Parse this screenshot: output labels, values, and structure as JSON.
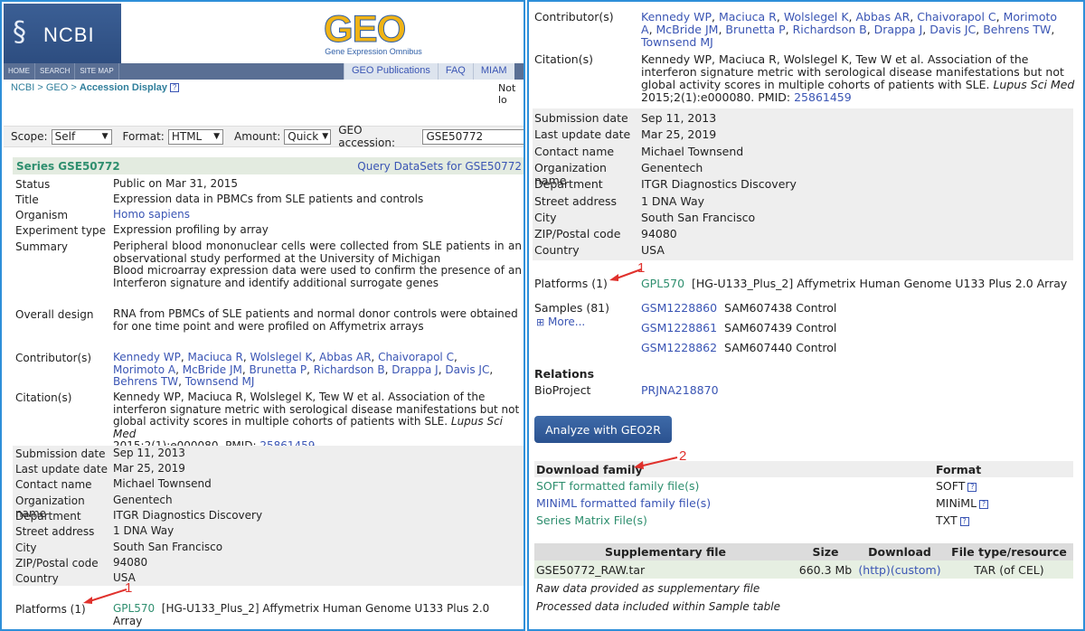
{
  "header": {
    "ncbi_text": "NCBI",
    "geo_word": "GEO",
    "geo_sub": "Gene Expression Omnibus",
    "nav": [
      "HOME",
      "SEARCH",
      "SITE MAP"
    ],
    "tabs": [
      "GEO Publications",
      "FAQ",
      "MIAM"
    ],
    "breadcrumb": {
      "ncbi": "NCBI",
      "sep1": " > ",
      "geo": "GEO",
      "sep2": " > ",
      "current": "Accession Display"
    },
    "not_logged": "Not lo"
  },
  "toolbar": {
    "scope_label": "Scope:",
    "scope_value": "Self",
    "format_label": "Format:",
    "format_value": "HTML",
    "amount_label": "Amount:",
    "amount_value": "Quick",
    "accession_label": "GEO accession:",
    "accession_value": "GSE50772"
  },
  "series": {
    "title": "Series GSE50772",
    "query_link": "Query DataSets for GSE50772"
  },
  "fields": {
    "status": {
      "label": "Status",
      "value": "Public on Mar 31, 2015"
    },
    "title": {
      "label": "Title",
      "value": "Expression data in PBMCs from SLE patients and controls"
    },
    "organism": {
      "label": "Organism",
      "value": "Homo sapiens"
    },
    "experiment_type": {
      "label": "Experiment type",
      "value": "Expression profiling by array"
    },
    "summary": {
      "label": "Summary",
      "line1": "Peripheral blood mononuclear cells were collected from SLE patients in an observational study performed at the University of Michigan",
      "line2": "Blood microarray expression data were used to confirm the presence of an Interferon signature and identify additional surrogate genes"
    },
    "overall_design": {
      "label": "Overall design",
      "value": "RNA from PBMCs of SLE patients and normal donor controls were obtained for one time point and were profiled on Affymetrix arrays"
    },
    "contributors": {
      "label": "Contributor(s)",
      "names": [
        "Kennedy WP",
        "Maciuca R",
        "Wolslegel K",
        "Abbas AR",
        "Chaivorapol C",
        "Morimoto A",
        "McBride JM",
        "Brunetta P",
        "Richardson B",
        "Drappa J",
        "Davis JC",
        "Behrens TW",
        "Townsend MJ"
      ]
    },
    "citation": {
      "label": "Citation(s)",
      "text": "Kennedy WP, Maciuca R, Wolslegel K, Tew W et al. Association of the interferon signature metric with serological disease manifestations but not global activity scores in multiple cohorts of patients with SLE.",
      "journal": "Lupus Sci Med",
      "ref": "2015;2(1):e000080. PMID:",
      "pmid": "25861459"
    },
    "submission_date": {
      "label": "Submission date",
      "value": "Sep 11, 2013"
    },
    "last_update": {
      "label": "Last update date",
      "value": "Mar 25, 2019"
    },
    "contact_name": {
      "label": "Contact name",
      "value": "Michael Townsend"
    },
    "organization": {
      "label": "Organization name",
      "value": "Genentech"
    },
    "department": {
      "label": "Department",
      "value": "ITGR Diagnostics Discovery"
    },
    "street": {
      "label": "Street address",
      "value": "1 DNA Way"
    },
    "city": {
      "label": "City",
      "value": "South San Francisco"
    },
    "zip": {
      "label": "ZIP/Postal code",
      "value": "94080"
    },
    "country": {
      "label": "Country",
      "value": "USA"
    },
    "platforms": {
      "label": "Platforms (1)",
      "id": "GPL570",
      "desc": "[HG-U133_Plus_2] Affymetrix Human Genome U133 Plus 2.0 Array"
    }
  },
  "samples": {
    "label": "Samples (81)",
    "more": "More...",
    "items": [
      {
        "id": "GSM1228860",
        "desc": "SAM607438 Control"
      },
      {
        "id": "GSM1228861",
        "desc": "SAM607439 Control"
      },
      {
        "id": "GSM1228862",
        "desc": "SAM607440 Control"
      }
    ]
  },
  "relations": {
    "title": "Relations",
    "label": "BioProject",
    "value": "PRJNA218870"
  },
  "analyze_button": "Analyze with GEO2R",
  "download": {
    "col_family": "Download family",
    "col_format": "Format",
    "rows": [
      {
        "name": "SOFT formatted family file(s)",
        "format": "SOFT"
      },
      {
        "name": "MINiML formatted family file(s)",
        "format": "MINiML"
      },
      {
        "name": "Series Matrix File(s)",
        "format": "TXT"
      }
    ]
  },
  "supplementary": {
    "cols": [
      "Supplementary file",
      "Size",
      "Download",
      "File type/resource"
    ],
    "row": {
      "file": "GSE50772_RAW.tar",
      "size": "660.3 Mb",
      "http": "(http)",
      "custom": "(custom)",
      "type": "TAR (of CEL)"
    },
    "note1": "Raw data provided as supplementary file",
    "note2": "Processed data included within Sample table"
  },
  "annotations": {
    "left_1": "1",
    "right_1": "1",
    "right_2": "2"
  },
  "colors": {
    "border": "#2e8fd9",
    "link": "#3a55b4",
    "green": "#2f8f6f",
    "annotation": "#e0312c"
  }
}
